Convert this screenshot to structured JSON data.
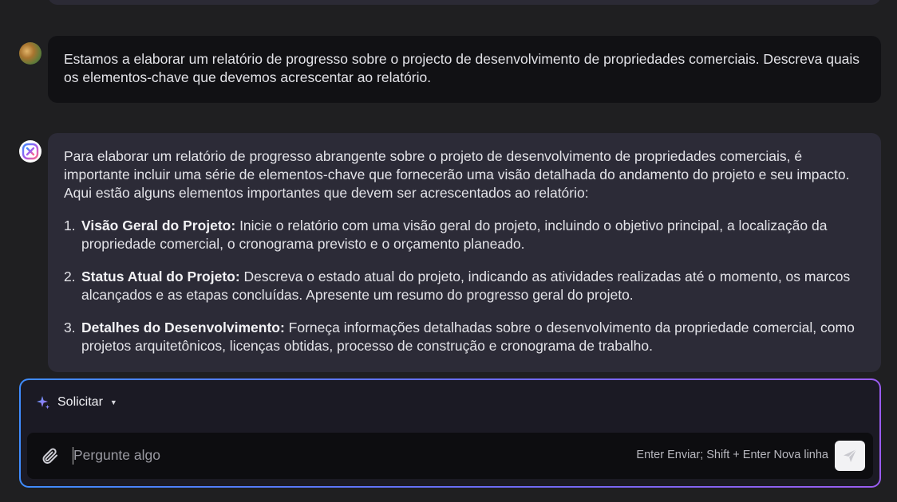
{
  "conversation": {
    "user_message": "Estamos a elaborar um relatório de progresso sobre o projecto de desenvolvimento de propriedades comerciais. Descreva quais os elementos-chave que devemos acrescentar ao relatório.",
    "assistant_intro": "Para elaborar um relatório de progresso abrangente sobre o projeto de desenvolvimento de propriedades comerciais, é importante incluir uma série de elementos-chave que fornecerão uma visão detalhada do andamento do projeto e seu impacto. Aqui estão alguns elementos importantes que devem ser acrescentados ao relatório:",
    "assistant_items": [
      {
        "number": "1.",
        "title": "Visão Geral do Projeto:",
        "text": " Inicie o relatório com uma visão geral do projeto, incluindo o objetivo principal, a localização da propriedade comercial, o cronograma previsto e o orçamento planeado."
      },
      {
        "number": "2.",
        "title": "Status Atual do Projeto:",
        "text": " Descreva o estado atual do projeto, indicando as atividades realizadas até o momento, os marcos alcançados e as etapas concluídas. Apresente um resumo do progresso geral do projeto."
      },
      {
        "number": "3.",
        "title": "Detalhes do Desenvolvimento:",
        "text": " Forneça informações detalhadas sobre o desenvolvimento da propriedade comercial, como projetos arquitetônicos, licenças obtidas, processo de construção e cronograma de trabalho."
      }
    ]
  },
  "composer": {
    "mode_label": "Solicitar",
    "placeholder": "Pergunte algo",
    "hint": "Enter Enviar; Shift + Enter Nova linha"
  },
  "icons": {
    "mode": "sparkle-icon",
    "attach": "paperclip-icon",
    "send": "send-icon"
  },
  "colors": {
    "accent_start": "#3f8cff",
    "accent_end": "#9a5cf0"
  }
}
